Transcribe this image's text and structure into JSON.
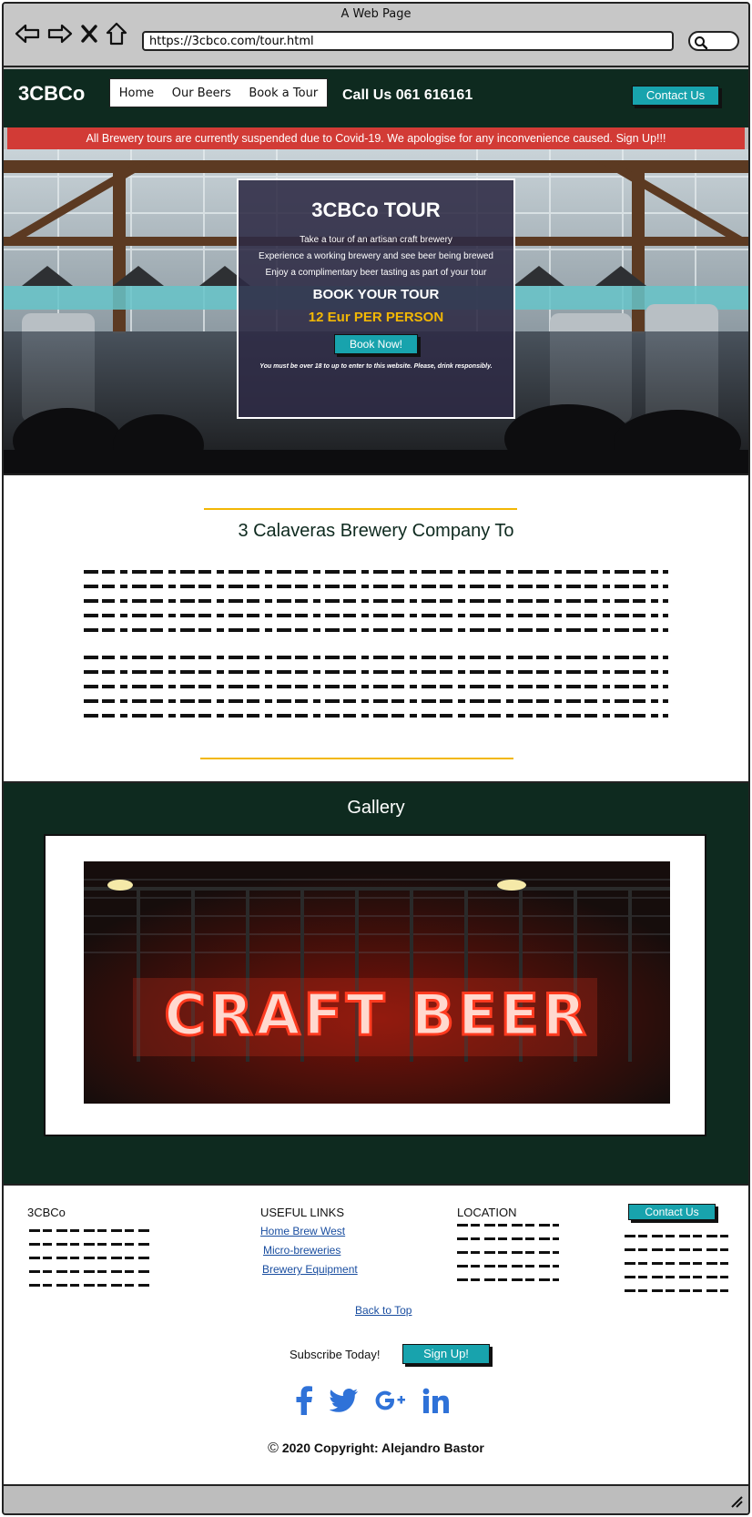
{
  "browser": {
    "window_title": "A Web Page",
    "url": "https://3cbco.com/tour.html"
  },
  "header": {
    "logo": "3CBCo",
    "nav": [
      "Home",
      "Our Beers",
      "Book a Tour"
    ],
    "call_us": "Call Us 061 616161",
    "contact_button": "Contact Us"
  },
  "banner": {
    "text": "All Brewery tours are currently suspended due to Covid-19. We apologise for any inconvenience caused. Sign Up!!!"
  },
  "tour": {
    "title": "3CBCo TOUR",
    "lines": [
      "Take a tour of an artisan craft brewery",
      "Experience a working brewery and see beer being brewed",
      "Enjoy a complimentary beer tasting as part of your tour"
    ],
    "book_heading": "BOOK YOUR TOUR",
    "price": "12 Eur PER PERSON",
    "book_button": "Book Now!",
    "age_note": "You must be over 18 to up to enter to this website. Please, drink responsibly."
  },
  "about": {
    "title": "3 Calaveras Brewery Company To"
  },
  "gallery": {
    "title": "Gallery",
    "sign_text": "CRAFT BEER"
  },
  "footer": {
    "brand": "3CBCo",
    "useful_links_title": "USEFUL LINKS",
    "links": [
      "Home Brew West",
      "Micro-breweries",
      "Brewery Equipment"
    ],
    "location_title": "LOCATION",
    "contact_button": "Contact Us",
    "back_to_top": "Back to Top",
    "subscribe_label": "Subscribe Today!",
    "signup_button": "Sign Up!",
    "social_icons": [
      "facebook-icon",
      "twitter-icon",
      "google-plus-icon",
      "linkedin-icon"
    ],
    "copyright_symbol": "©",
    "copyright": "2020 Copyright: Alejandro Bastor"
  },
  "colors": {
    "brand_dark_green": "#0e2a1f",
    "accent_teal": "#18a3ad",
    "alert_red": "#d23b36",
    "gold": "#f2b705",
    "link_blue": "#1a4ea0",
    "social_blue": "#2f72d8"
  }
}
